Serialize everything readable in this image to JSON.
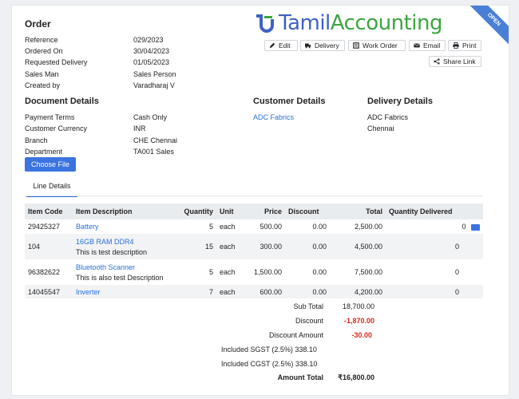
{
  "order": {
    "title": "Order",
    "fields": [
      {
        "label": "Reference",
        "value": "029/2023"
      },
      {
        "label": "Ordered On",
        "value": "30/04/2023"
      },
      {
        "label": "Requested Delivery",
        "value": "01/05/2023"
      },
      {
        "label": "Sales Man",
        "value": "Sales Person"
      },
      {
        "label": "Created by",
        "value": "Varadharaj V"
      }
    ]
  },
  "brand": {
    "part1": "Tamil",
    "part2": "Accounting",
    "ribbon": "OPEN",
    "mark_color": "#3ca63e",
    "blue": "#3e61c4"
  },
  "actions": {
    "edit": "Edit",
    "delivery": "Delivery",
    "work_order": "Work Order",
    "email": "Email",
    "print": "Print",
    "share": "Share Link"
  },
  "document": {
    "heading": "Document Details",
    "fields": [
      {
        "label": "Payment Terms",
        "value": "Cash Only"
      },
      {
        "label": "Customer Currency",
        "value": "INR"
      },
      {
        "label": "Branch",
        "value": "CHE Chennai"
      },
      {
        "label": "Department",
        "value": "TA001 Sales"
      }
    ],
    "choose_file": "Choose File"
  },
  "customer": {
    "heading": "Customer Details",
    "name": "ADC Fabrics"
  },
  "delivery": {
    "heading": "Delivery Details",
    "name": "ADC Fabrics",
    "city": "Chennai"
  },
  "tabs": {
    "line_details": "Line Details"
  },
  "table": {
    "headers": [
      "Item Code",
      "Item Description",
      "Quantity",
      "Unit",
      "Price",
      "Discount",
      "Total",
      "Quantity Delivered"
    ],
    "rows": [
      {
        "code": "29425327",
        "desc": "Battery",
        "note": "",
        "qty": "5",
        "unit": "each",
        "price": "500.00",
        "discount": "0.00",
        "total": "2,500.00",
        "delivered": "0"
      },
      {
        "code": "104",
        "desc": "16GB RAM DDR4",
        "note": "This is test description",
        "qty": "15",
        "unit": "each",
        "price": "300.00",
        "discount": "0.00",
        "total": "4,500.00",
        "delivered": "0"
      },
      {
        "code": "96382622",
        "desc": "Bluetooth Scanner",
        "note": "This is also test Description",
        "qty": "5",
        "unit": "each",
        "price": "1,500.00",
        "discount": "0.00",
        "total": "7,500.00",
        "delivered": "0"
      },
      {
        "code": "14045547",
        "desc": "Inverter",
        "note": "",
        "qty": "7",
        "unit": "each",
        "price": "600.00",
        "discount": "0.00",
        "total": "4,200.00",
        "delivered": "0"
      }
    ]
  },
  "totals": {
    "sub_total_label": "Sub Total",
    "sub_total": "18,700.00",
    "discount_label": "Discount",
    "discount": "-1,870.00",
    "discount_amount_label": "Discount Amount",
    "discount_amount": "-30.00",
    "sgst": "Included SGST (2.5%) 338.10",
    "cgst": "Included CGST (2.5%) 338.10",
    "amount_total_label": "Amount Total",
    "amount_total": "₹16,800.00"
  }
}
